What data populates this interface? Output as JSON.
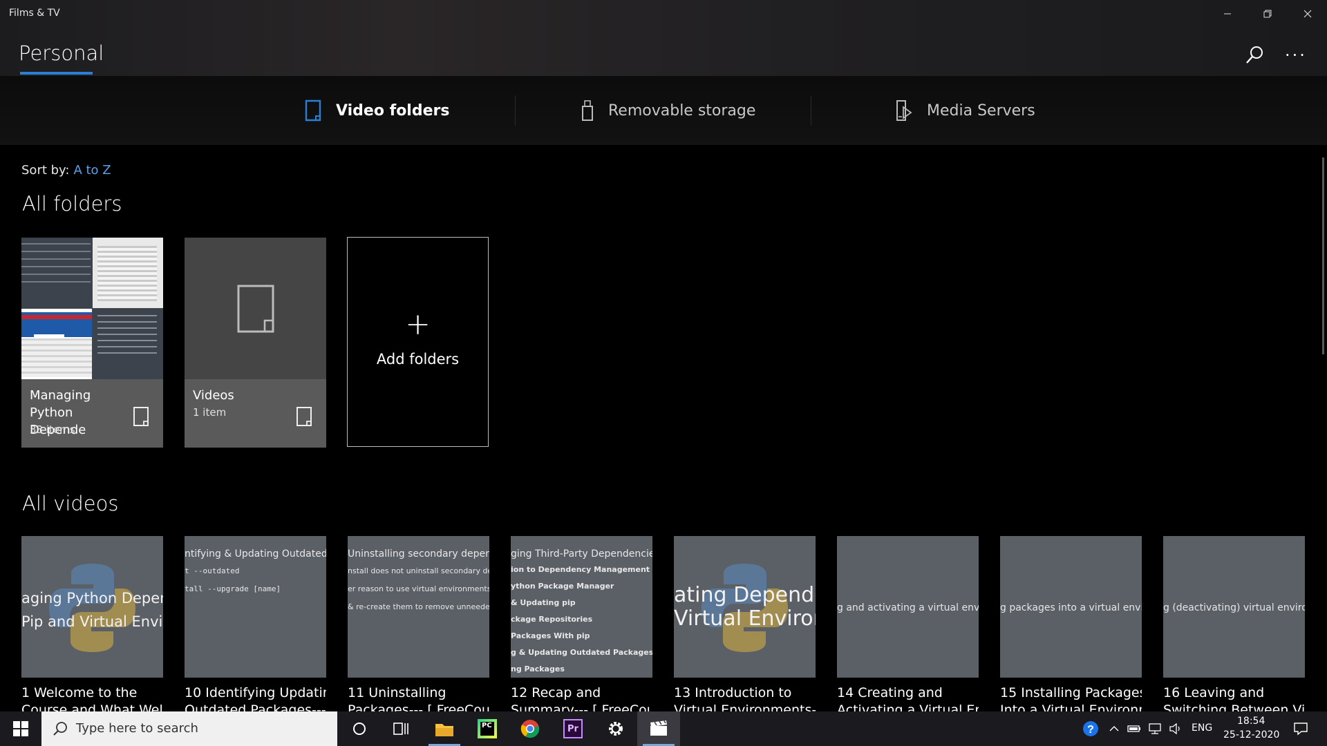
{
  "window": {
    "app_title": "Films & TV"
  },
  "header": {
    "page_title": "Personal"
  },
  "tabs": [
    {
      "label": "Video folders",
      "icon": "folder-icon",
      "active": true
    },
    {
      "label": "Removable storage",
      "icon": "usb-drive-icon",
      "active": false
    },
    {
      "label": "Media Servers",
      "icon": "media-server-icon",
      "active": false
    }
  ],
  "sort": {
    "label": "Sort by:",
    "value": "A to Z"
  },
  "folders_section": {
    "title": "All folders",
    "folders": [
      {
        "name": "Managing Python Depende",
        "count": "33 items"
      },
      {
        "name": "Videos",
        "count": "1 item"
      }
    ],
    "add_label": "Add folders"
  },
  "videos_section": {
    "title": "All videos",
    "videos": [
      {
        "line1": "1 Welcome to the",
        "line2": "Course and What Well Cc",
        "thumb_text": "aging Python Depender\nPip and Virtual Environn"
      },
      {
        "line1": "10 Identifying  Updating",
        "line2": "Outdated Packages--- [ F",
        "thumb_text": "ntifying & Updating Outdated Packa\nt --outdated\ntall --upgrade [name]"
      },
      {
        "line1": "11 Uninstalling",
        "line2": "Packages--- [ FreeCourse",
        "thumb_text": "Uninstalling secondary dependencie\nnstall does not uninstall secondary depe\ner reason to use virtual environments:\n& re-create them to remove unneeded sec"
      },
      {
        "line1": "12 Recap and",
        "line2": "Summary--- [ FreeCourse",
        "thumb_text": "ging Third-Party Dependencies With\nion to Dependency Management\nython Package Manager\n& Updating pip\nckage Repositories\nPackages With pip\ng & Updating Outdated Packages\nng Packages"
      },
      {
        "line1": "13 Introduction to",
        "line2": "Virtual Environments--- [",
        "thumb_text": "ating Dependenc\nVirtual Environm"
      },
      {
        "line1": "14 Creating and",
        "line2": "Activating a Virtual Envirc",
        "thumb_text": "g and activating a virtual envir"
      },
      {
        "line1": "15 Installing Packages",
        "line2": "Into a Virtual Environmer",
        "thumb_text": "g packages into a virtual envir"
      },
      {
        "line1": "16 Leaving and",
        "line2": "Switching Between Virtua",
        "thumb_text": "g (deactivating) virtual environ"
      }
    ]
  },
  "taskbar": {
    "search_placeholder": "Type here to search",
    "apps": [
      "cortana-icon",
      "task-view-icon",
      "file-explorer-icon",
      "pycharm-icon",
      "chrome-icon",
      "premiere-icon",
      "settings-icon",
      "films-tv-icon"
    ],
    "pycharm_label": "PC",
    "premiere_label": "Pr",
    "language": "ENG",
    "time": "18:54",
    "date": "25-12-2020"
  },
  "colors": {
    "accent": "#2b7fd6",
    "link": "#5aa0ea",
    "taskbar": "#1b1b1f"
  }
}
